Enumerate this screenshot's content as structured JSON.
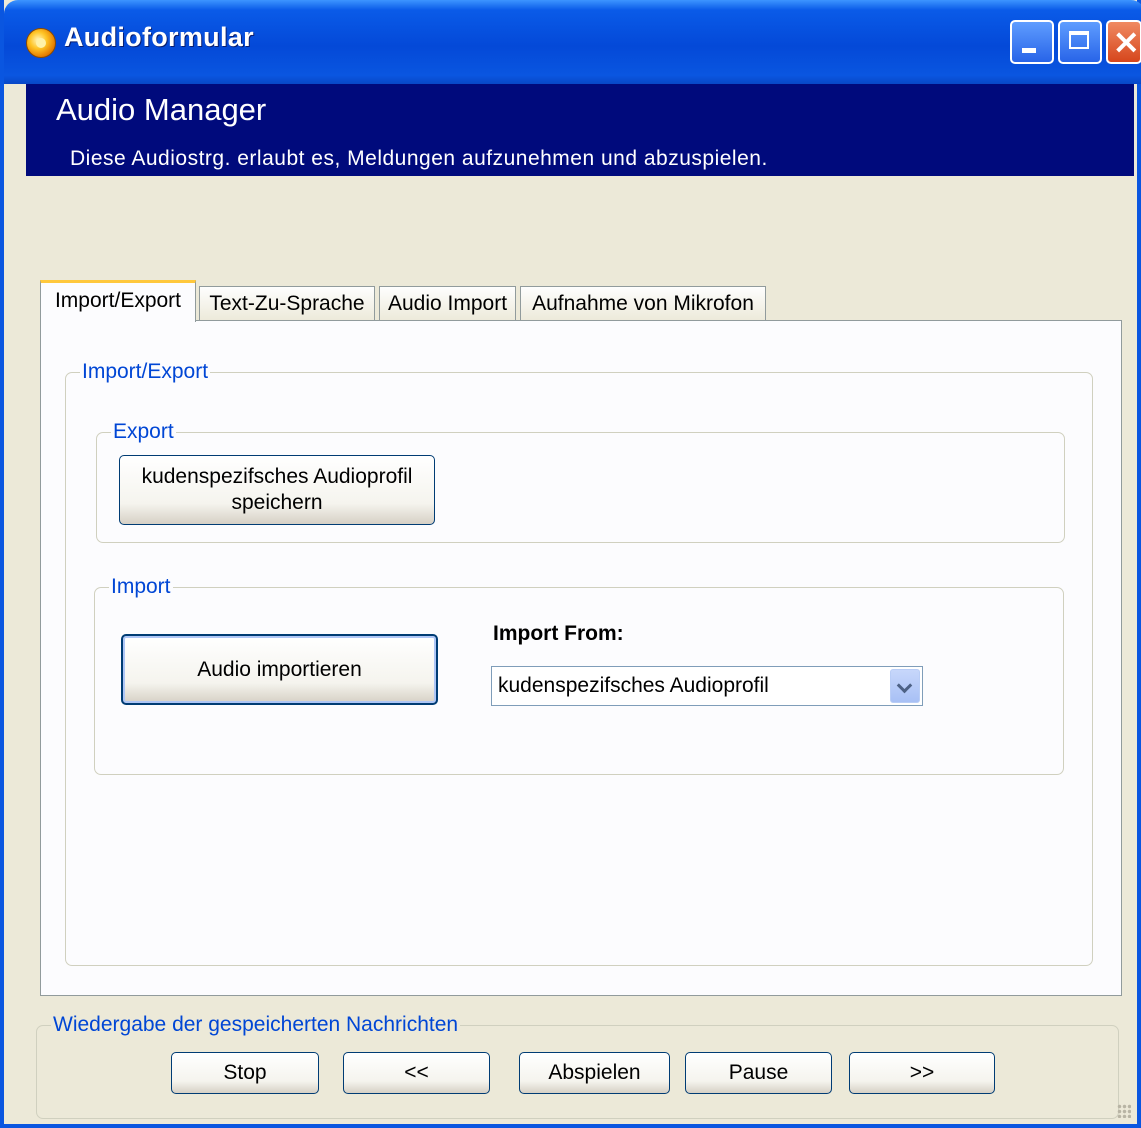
{
  "window": {
    "title": "Audioformular"
  },
  "header": {
    "title": "Audio Manager",
    "subtitle": "Diese Audiostrg. erlaubt es, Meldungen aufzunehmen und abzuspielen."
  },
  "tabs": [
    {
      "label": "Import/Export",
      "active": true
    },
    {
      "label": "Text-Zu-Sprache",
      "active": false
    },
    {
      "label": "Audio Import",
      "active": false
    },
    {
      "label": "Aufnahme von Mikrofon",
      "active": false
    }
  ],
  "import_export": {
    "group_label": "Import/Export",
    "export": {
      "group_label": "Export",
      "save_button_line1": "kudenspezifsches Audioprofil",
      "save_button_line2": "speichern"
    },
    "import": {
      "group_label": "Import",
      "import_button": "Audio importieren",
      "import_from_label": "Import From:",
      "import_from_selected": "kudenspezifsches Audioprofil"
    }
  },
  "playback": {
    "group_label": "Wiedergabe der gespeicherten Nachrichten",
    "buttons": {
      "stop": "Stop",
      "previous": "<<",
      "play": "Abspielen",
      "pause": "Pause",
      "next": ">>"
    }
  },
  "colors": {
    "titlebar": "#0a56e0",
    "banner": "#000a7c",
    "legend_text": "#0046d5",
    "window_bg": "#ece9d8"
  }
}
